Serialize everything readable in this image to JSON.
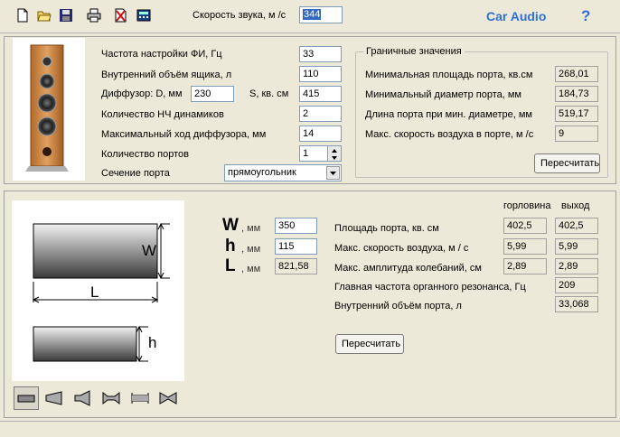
{
  "toolbar": {
    "icons": [
      "new-file-icon",
      "open-folder-icon",
      "save-icon",
      "print-icon",
      "delete-icon",
      "calculator-icon"
    ],
    "sound_speed_label": "Скорость звука, м /с",
    "sound_speed_value": "344",
    "brand": "Car Audio",
    "help": "?"
  },
  "enclosure": {
    "tuning_label": "Частота настройки ФИ, Гц",
    "tuning_value": "33",
    "volume_label": "Внутренний объём ящика, л",
    "volume_value": "110",
    "diaphragm_label": "Диффузор: D, мм",
    "diaphragm_value": "230",
    "area_label": "S, кв. см",
    "area_value": "415",
    "woofers_label": "Количество НЧ динамиков",
    "woofers_value": "2",
    "xmax_label": "Максимальный ход диффузора, мм",
    "xmax_value": "14",
    "ports_label": "Количество портов",
    "ports_value": "1",
    "section_label": "Сечение порта",
    "section_value": "прямоугольник"
  },
  "limits": {
    "title": "Граничные значения",
    "rows": [
      {
        "label": "Минимальная площадь порта, кв.см",
        "value": "268,01"
      },
      {
        "label": "Минимальный диаметр порта, мм",
        "value": "184,73"
      },
      {
        "label": "Длина порта при мин. диаметре, мм",
        "value": "519,17"
      },
      {
        "label": "Макс. скорость воздуха в порте, м /с",
        "value": "9"
      }
    ],
    "recalc": "Пересчитать"
  },
  "port": {
    "w_letter": "W",
    "h_letter": "h",
    "l_letter": "L",
    "unit": ", мм",
    "w_value": "350",
    "h_value": "115",
    "l_value": "821,58",
    "col_throat": "горловина",
    "col_exit": "выход",
    "rows": [
      {
        "label": "Площадь порта, кв. см",
        "throat": "402,5",
        "exit": "402,5"
      },
      {
        "label": "Макс. скорость воздуха, м / с",
        "throat": "5,99",
        "exit": "5,99"
      },
      {
        "label": "Макс. амплитуда колебаний, см",
        "throat": "2,89",
        "exit": "2,89"
      }
    ],
    "resonance_label": "Главная частота органного резонанса, Гц",
    "resonance_value": "209",
    "inner_volume_label": "Внутренний объём порта, л",
    "inner_volume_value": "33,068",
    "recalc": "Пересчитать",
    "diagram_w": "W",
    "diagram_l": "L",
    "diagram_h": "h"
  },
  "shapes": [
    "rectangle-port-icon",
    "cone-port-icon",
    "horn-port-icon",
    "flared-port-icon",
    "double-flare-port-icon",
    "bowtie-port-icon"
  ]
}
